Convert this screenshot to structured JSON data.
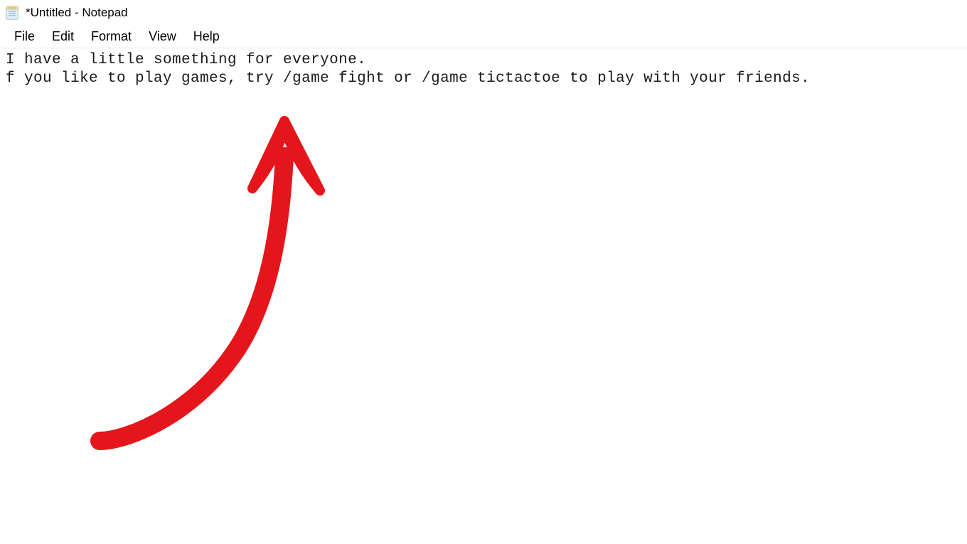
{
  "window": {
    "title": "*Untitled - Notepad"
  },
  "menu": {
    "items": [
      "File",
      "Edit",
      "Format",
      "View",
      "Help"
    ]
  },
  "editor": {
    "line1": "I have a little something for everyone.",
    "line2": "f you like to play games, try /game fight or /game tictactoe to play with your friends."
  },
  "annotation": {
    "arrow_color": "#e4161b"
  }
}
